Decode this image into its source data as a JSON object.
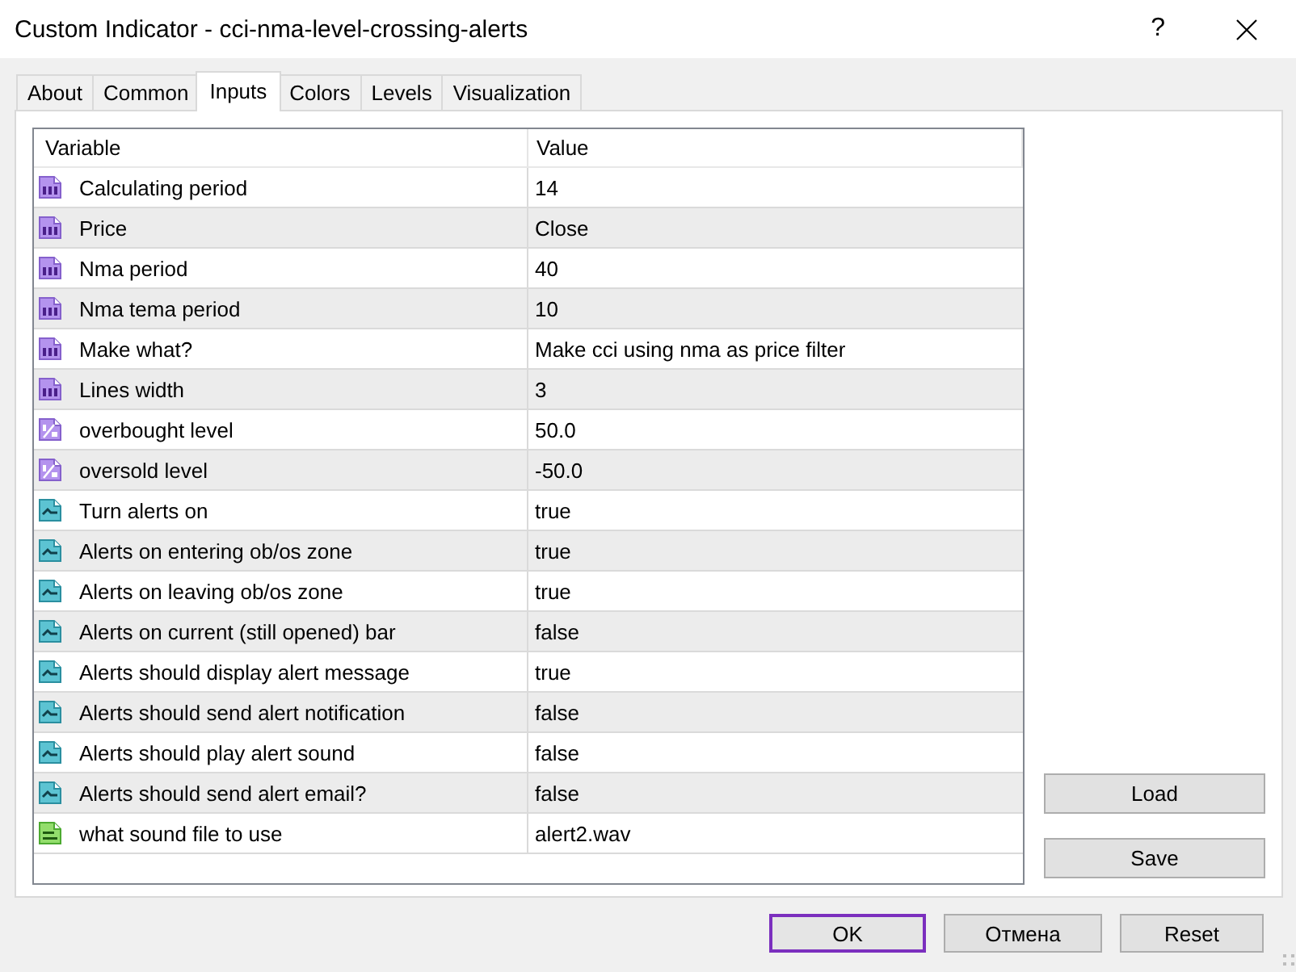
{
  "window": {
    "title": "Custom Indicator - cci-nma-level-crossing-alerts",
    "help_button": "?"
  },
  "tabs": [
    {
      "label": "About",
      "selected": false
    },
    {
      "label": "Common",
      "selected": false
    },
    {
      "label": "Inputs",
      "selected": true
    },
    {
      "label": "Colors",
      "selected": false
    },
    {
      "label": "Levels",
      "selected": false
    },
    {
      "label": "Visualization",
      "selected": false
    }
  ],
  "inputs_table": {
    "columns": [
      "Variable",
      "Value"
    ],
    "rows": [
      {
        "kind": "integer",
        "variable": "Calculating period",
        "value": "14"
      },
      {
        "kind": "integer",
        "variable": "Price",
        "value": "Close"
      },
      {
        "kind": "integer",
        "variable": "Nma period",
        "value": "40"
      },
      {
        "kind": "integer",
        "variable": "Nma tema period",
        "value": "10"
      },
      {
        "kind": "integer",
        "variable": "Make what?",
        "value": "Make cci using nma as price filter"
      },
      {
        "kind": "integer",
        "variable": "Lines width",
        "value": "3"
      },
      {
        "kind": "double",
        "variable": "overbought level",
        "value": "50.0"
      },
      {
        "kind": "double",
        "variable": "oversold level",
        "value": "-50.0"
      },
      {
        "kind": "bool",
        "variable": "Turn alerts on",
        "value": "true"
      },
      {
        "kind": "bool",
        "variable": "Alerts on entering ob/os zone",
        "value": "true"
      },
      {
        "kind": "bool",
        "variable": "Alerts on leaving ob/os zone",
        "value": "true"
      },
      {
        "kind": "bool",
        "variable": "Alerts on current (still opened) bar",
        "value": "false"
      },
      {
        "kind": "bool",
        "variable": "Alerts should display alert message",
        "value": "true"
      },
      {
        "kind": "bool",
        "variable": "Alerts should send alert notification",
        "value": "false"
      },
      {
        "kind": "bool",
        "variable": "Alerts should play alert sound",
        "value": "false"
      },
      {
        "kind": "bool",
        "variable": "Alerts should send alert email?",
        "value": "false"
      },
      {
        "kind": "string",
        "variable": "what sound file to use",
        "value": "alert2.wav"
      }
    ]
  },
  "side_buttons": [
    {
      "label": "Load"
    },
    {
      "label": "Save"
    }
  ],
  "footer_buttons": [
    {
      "label": "OK",
      "focused": true
    },
    {
      "label": "Отмена",
      "focused": false
    },
    {
      "label": "Reset",
      "focused": false
    }
  ]
}
